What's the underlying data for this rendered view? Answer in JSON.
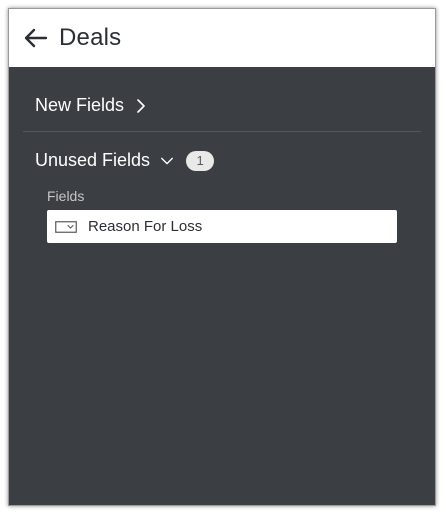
{
  "header": {
    "back_icon": "arrow-left-icon",
    "title": "Deals"
  },
  "sections": {
    "new_fields": {
      "title": "New Fields",
      "icon": "chevron-right-icon"
    },
    "unused_fields": {
      "title": "Unused Fields",
      "icon": "chevron-down-icon",
      "count": "1",
      "fields_label": "Fields",
      "items": [
        {
          "label": "Reason For Loss",
          "icon": "dropdown-field-icon"
        }
      ]
    }
  },
  "colors": {
    "panel_background": "#3b3e42",
    "header_background": "#ffffff",
    "badge_background": "#e9e9e9"
  }
}
